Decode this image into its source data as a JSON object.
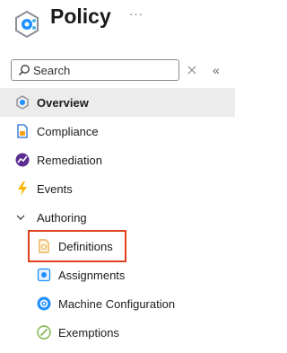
{
  "header": {
    "title": "Policy",
    "more_label": "···"
  },
  "search": {
    "placeholder": "Search",
    "value": ""
  },
  "nav": {
    "overview": "Overview",
    "compliance": "Compliance",
    "remediation": "Remediation",
    "events": "Events",
    "authoring": "Authoring",
    "definitions": "Definitions",
    "assignments": "Assignments",
    "machine_configuration": "Machine Configuration",
    "exemptions": "Exemptions"
  },
  "colors": {
    "accent": "#0078d4",
    "selected_bg": "#ececec",
    "highlight": "#e0401c"
  },
  "icons": {
    "app": "policy-icon",
    "search": "search-icon",
    "clear": "close-icon",
    "collapse": "double-chevron-left-icon"
  }
}
